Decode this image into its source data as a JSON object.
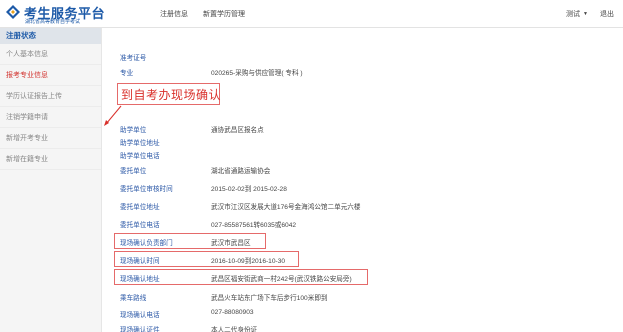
{
  "header": {
    "logo_title": "考生服务平台",
    "logo_subtitle": "湖北省高等教育自学考试",
    "nav": [
      "注册信息",
      "新置学历管理"
    ],
    "user_label": "测试",
    "logout_label": "退出"
  },
  "sidebar": {
    "heading": "注册状态",
    "items": [
      {
        "label": "个人基本信息",
        "active": false
      },
      {
        "label": "报考专业信息",
        "active": true
      },
      {
        "label": "学历认证报告上传",
        "active": false
      },
      {
        "label": "注销学籍申请",
        "active": false
      },
      {
        "label": "新增开考专业",
        "active": false
      },
      {
        "label": "新增在籍专业",
        "active": false
      }
    ]
  },
  "main": {
    "callout": "到自考办现场确认",
    "rows_top": [
      {
        "label": "准考证号",
        "value": ""
      },
      {
        "label": "专业",
        "value": "020265-采购与供应管理( 专科 )"
      }
    ],
    "rows": [
      {
        "label": "助学单位",
        "value": "通协武昌区报名点"
      },
      {
        "label": "助学单位地址",
        "value": ""
      },
      {
        "label": "助学单位电话",
        "value": ""
      },
      {
        "label": "委托单位",
        "value": "湖北省通路运输协会"
      },
      {
        "label": "委托单位审核时间",
        "value": "2015-02-02到 2015-02-28"
      },
      {
        "label": "委托单位地址",
        "value": "武汉市江汉区发展大道176号金海鸿公馆二单元六楼"
      },
      {
        "label": "委托单位电话",
        "value": "027-85587561转6035或6042"
      },
      {
        "label": "现场确认负责部门",
        "value": "武汉市武昌区"
      },
      {
        "label": "现场确认时间",
        "value": "2016-10-09到2016-10-30"
      },
      {
        "label": "现场确认地址",
        "value": "武昌区福安街武商一村242号(武汉铁路公安局旁)"
      },
      {
        "label": "乘车路线",
        "value": "武昌火车站东广场下车后步行100米即到"
      },
      {
        "label": "现场确认电话",
        "value": "027-88080903"
      },
      {
        "label": "现场确认证件",
        "value": "本人二代身份证"
      }
    ]
  },
  "colors": {
    "brand_blue": "#1d5aa8",
    "label_blue": "#2a57a6",
    "highlight_red": "#d9302b"
  }
}
